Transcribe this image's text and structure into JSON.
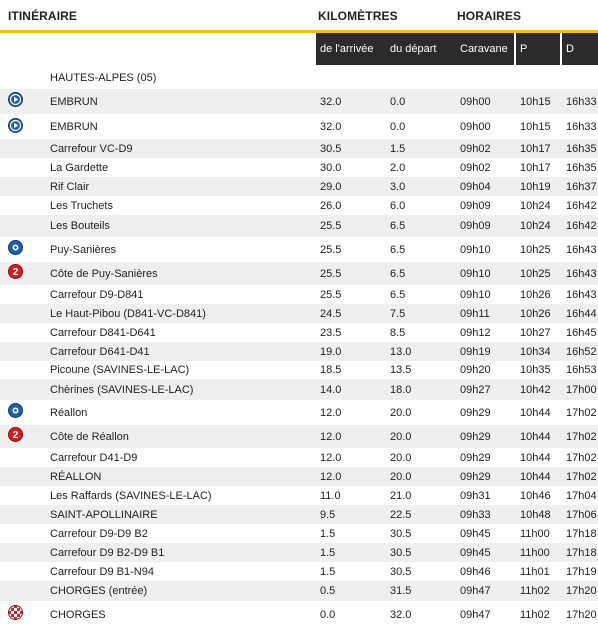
{
  "header": {
    "itineraire": "ITINÉRAIRE",
    "kilometres": "KILOMÈTRES",
    "horaires": "HORAIRES"
  },
  "subheader": {
    "de_larrivee": "de l'arrivée",
    "du_depart": "du départ",
    "caravane": "Caravane",
    "p": "P",
    "d": "D"
  },
  "colors": {
    "accent": "#f2c10a",
    "header_bg": "#2b2b2b",
    "row_alt": "#efefef",
    "icon_blue": "#1f5fa8",
    "icon_red": "#d42020"
  },
  "section": "HAUTES-ALPES (05)",
  "rows": [
    {
      "icon": "play-icon",
      "name": "EMBRUN",
      "arr": "32.0",
      "dep": "0.0",
      "car": "09h00",
      "p": "10h15",
      "d": "16h33"
    },
    {
      "icon": "play-icon",
      "name": "EMBRUN",
      "arr": "32.0",
      "dep": "0.0",
      "car": "09h00",
      "p": "10h15",
      "d": "16h33"
    },
    {
      "icon": "",
      "name": "Carrefour VC-D9",
      "arr": "30.5",
      "dep": "1.5",
      "car": "09h02",
      "p": "10h17",
      "d": "16h35"
    },
    {
      "icon": "",
      "name": "La Gardette",
      "arr": "30.0",
      "dep": "2.0",
      "car": "09h02",
      "p": "10h17",
      "d": "16h35"
    },
    {
      "icon": "",
      "name": "Rif Clair",
      "arr": "29.0",
      "dep": "3.0",
      "car": "09h04",
      "p": "10h19",
      "d": "16h37"
    },
    {
      "icon": "",
      "name": "Les Truchets",
      "arr": "26.0",
      "dep": "6.0",
      "car": "09h09",
      "p": "10h24",
      "d": "16h42"
    },
    {
      "icon": "",
      "name": "Les Bouteils",
      "arr": "25.5",
      "dep": "6.5",
      "car": "09h09",
      "p": "10h24",
      "d": "16h42"
    },
    {
      "icon": "sprint-icon",
      "name": "Puy-Sanières",
      "arr": "25.5",
      "dep": "6.5",
      "car": "09h10",
      "p": "10h25",
      "d": "16h43"
    },
    {
      "icon": "climb-icon",
      "name": "Côte de Puy-Sanières",
      "arr": "25.5",
      "dep": "6.5",
      "car": "09h10",
      "p": "10h25",
      "d": "16h43"
    },
    {
      "icon": "",
      "name": "Carrefour D9-D841",
      "arr": "25.5",
      "dep": "6.5",
      "car": "09h10",
      "p": "10h26",
      "d": "16h43"
    },
    {
      "icon": "",
      "name": "Le Haut-Pibou (D841-VC-D841)",
      "arr": "24.5",
      "dep": "7.5",
      "car": "09h11",
      "p": "10h26",
      "d": "16h44"
    },
    {
      "icon": "",
      "name": "Carrefour D841-D641",
      "arr": "23.5",
      "dep": "8.5",
      "car": "09h12",
      "p": "10h27",
      "d": "16h45"
    },
    {
      "icon": "",
      "name": "Carrefour D641-D41",
      "arr": "19.0",
      "dep": "13.0",
      "car": "09h19",
      "p": "10h34",
      "d": "16h52"
    },
    {
      "icon": "",
      "name": "Picoune (SAVINES-LE-LAC)",
      "arr": "18.5",
      "dep": "13.5",
      "car": "09h20",
      "p": "10h35",
      "d": "16h53"
    },
    {
      "icon": "",
      "name": "Chèrines (SAVINES-LE-LAC)",
      "arr": "14.0",
      "dep": "18.0",
      "car": "09h27",
      "p": "10h42",
      "d": "17h00"
    },
    {
      "icon": "sprint-icon",
      "name": "Réallon",
      "arr": "12.0",
      "dep": "20.0",
      "car": "09h29",
      "p": "10h44",
      "d": "17h02"
    },
    {
      "icon": "climb-icon",
      "name": "Côte de Réallon",
      "arr": "12.0",
      "dep": "20.0",
      "car": "09h29",
      "p": "10h44",
      "d": "17h02"
    },
    {
      "icon": "",
      "name": "Carrefour D41-D9",
      "arr": "12.0",
      "dep": "20.0",
      "car": "09h29",
      "p": "10h44",
      "d": "17h02"
    },
    {
      "icon": "",
      "name": "RÉALLON",
      "arr": "12.0",
      "dep": "20.0",
      "car": "09h29",
      "p": "10h44",
      "d": "17h02"
    },
    {
      "icon": "",
      "name": "Les Raffards (SAVINES-LE-LAC)",
      "arr": "11.0",
      "dep": "21.0",
      "car": "09h31",
      "p": "10h46",
      "d": "17h04"
    },
    {
      "icon": "",
      "name": "SAINT-APOLLINAIRE",
      "arr": "9.5",
      "dep": "22.5",
      "car": "09h33",
      "p": "10h48",
      "d": "17h06"
    },
    {
      "icon": "",
      "name": "Carrefour D9-D9 B2",
      "arr": "1.5",
      "dep": "30.5",
      "car": "09h45",
      "p": "11h00",
      "d": "17h18"
    },
    {
      "icon": "",
      "name": "Carrefour D9 B2-D9 B1",
      "arr": "1.5",
      "dep": "30.5",
      "car": "09h45",
      "p": "11h00",
      "d": "17h18"
    },
    {
      "icon": "",
      "name": "Carrefour D9 B1-N94",
      "arr": "1.5",
      "dep": "30.5",
      "car": "09h46",
      "p": "11h01",
      "d": "17h19"
    },
    {
      "icon": "",
      "name": "CHORGES (entrée)",
      "arr": "0.5",
      "dep": "31.5",
      "car": "09h47",
      "p": "11h02",
      "d": "17h20"
    },
    {
      "icon": "finish-flag-icon",
      "name": "CHORGES",
      "arr": "0.0",
      "dep": "32.0",
      "car": "09h47",
      "p": "11h02",
      "d": "17h20"
    }
  ]
}
